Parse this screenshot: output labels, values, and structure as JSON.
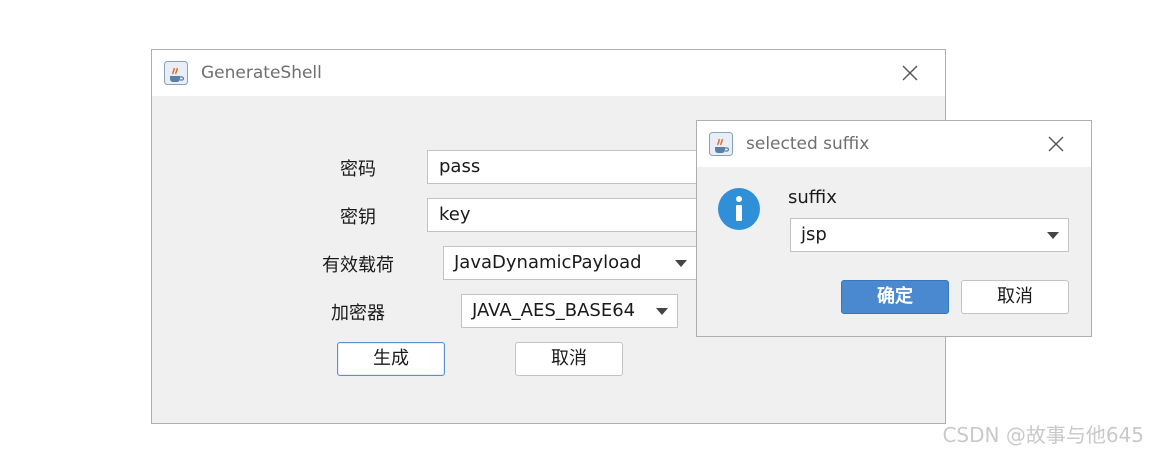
{
  "main_window": {
    "title": "GenerateShell",
    "fields": {
      "password_label": "密码",
      "password_value": "pass",
      "key_label": "密钥",
      "key_value": "key",
      "payload_label": "有效载荷",
      "payload_value": "JavaDynamicPayload",
      "encryptor_label": "加密器",
      "encryptor_value": "JAVA_AES_BASE64"
    },
    "buttons": {
      "generate": "生成",
      "cancel": "取消"
    }
  },
  "dialog": {
    "title": "selected suffix",
    "prompt": "suffix",
    "suffix_value": "jsp",
    "buttons": {
      "ok": "确定",
      "cancel": "取消"
    }
  },
  "watermark": "CSDN @故事与他645",
  "colors": {
    "primary_button": "#4a89d0",
    "info_icon": "#2f8fd8",
    "window_bg": "#f0f0f0"
  },
  "icons": [
    "java-cup-icon",
    "close-icon",
    "info-icon",
    "dropdown-arrow-icon"
  ]
}
